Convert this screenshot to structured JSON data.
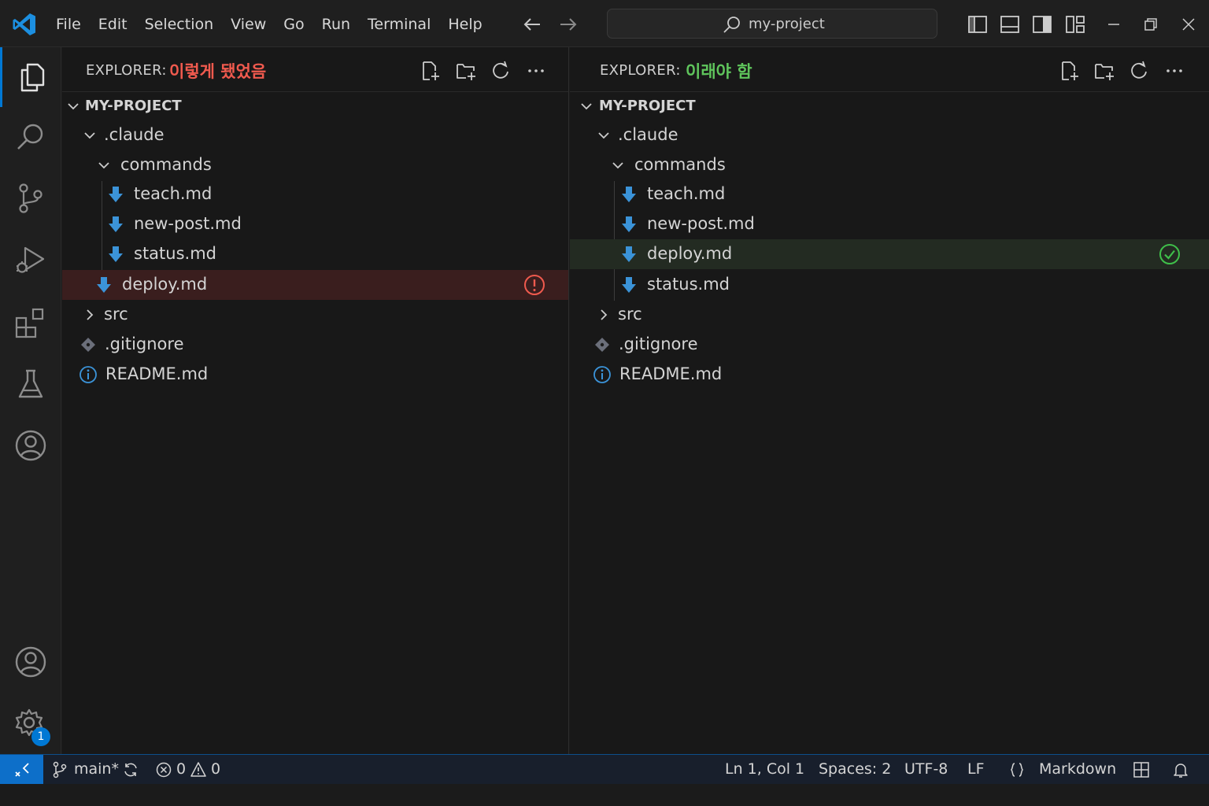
{
  "menu": [
    "File",
    "Edit",
    "Selection",
    "View",
    "Go",
    "Run",
    "Terminal",
    "Help"
  ],
  "search": {
    "text": "my-project"
  },
  "left_panel": {
    "header_label": "EXPLORER:",
    "header_tag": "이렇게 됐었음",
    "tag_color": "#f05a4e",
    "root": "MY-PROJECT",
    "claude_folder": ".claude",
    "commands_folder": "commands",
    "files": [
      "teach.md",
      "new-post.md",
      "status.md"
    ],
    "misplaced_file": "deploy.md",
    "src": "src",
    "gitignore": ".gitignore",
    "readme": "README.md"
  },
  "right_panel": {
    "header_label": "EXPLORER:",
    "header_tag": "이래야 함",
    "tag_color": "#5fc55c",
    "root": "MY-PROJECT",
    "claude_folder": ".claude",
    "commands_folder": "commands",
    "files": [
      "teach.md",
      "new-post.md",
      "deploy.md",
      "status.md"
    ],
    "src": "src",
    "gitignore": ".gitignore",
    "readme": "README.md"
  },
  "activity": {
    "settings_badge": "1"
  },
  "statusbar": {
    "branch": "main*",
    "errors": "0",
    "warnings": "0",
    "position": "Ln 1, Col 1",
    "spaces": "Spaces: 2",
    "encoding": "UTF-8",
    "eol": "LF",
    "language": "Markdown"
  },
  "colors": {
    "accent": "#0078d4",
    "md_icon": "#3b93d8",
    "error": "#f05a4e",
    "ok": "#3fbf4a"
  }
}
